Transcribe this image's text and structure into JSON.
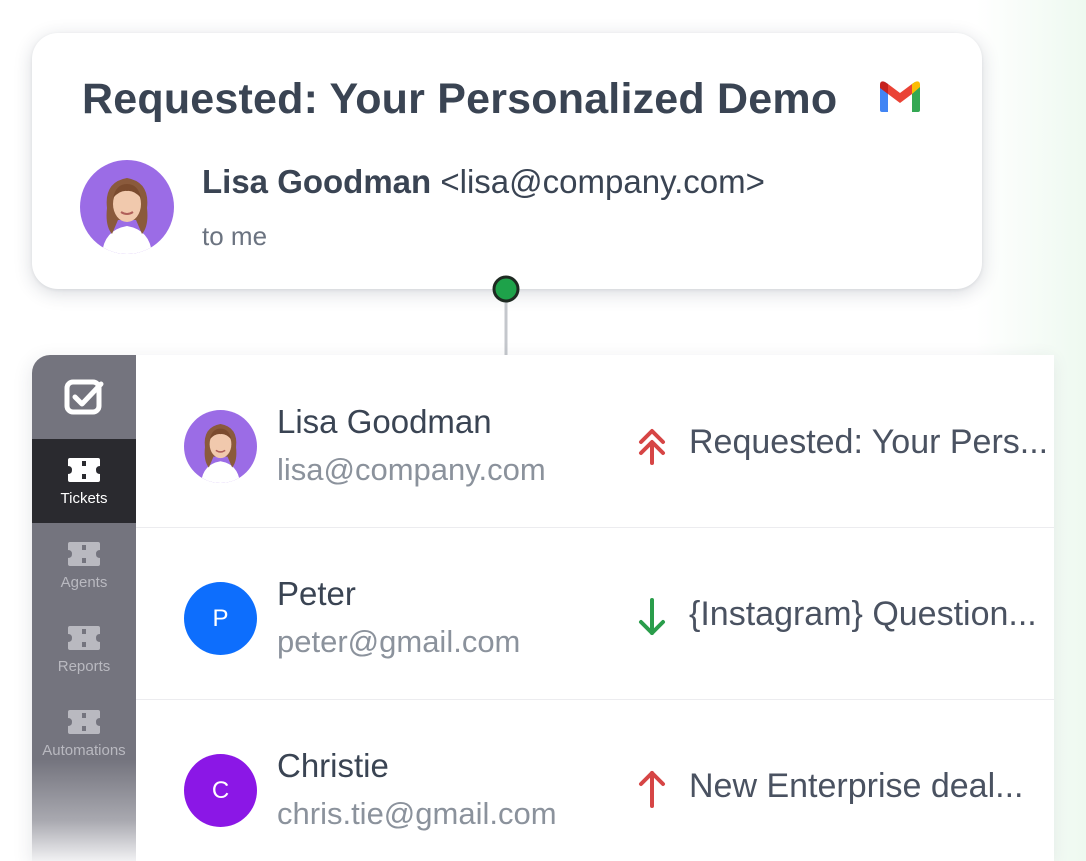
{
  "email": {
    "subject": "Requested: Your Personalized Demo",
    "sender_name": "Lisa Goodman",
    "sender_email": "<lisa@company.com>",
    "recipient": "to me",
    "client_icon": "gmail-icon"
  },
  "sidebar": {
    "logo_icon": "checkbox-logo-icon",
    "items": [
      {
        "label": "Tickets",
        "icon": "ticket-icon",
        "active": true
      },
      {
        "label": "Agents",
        "icon": "ticket-icon",
        "active": false
      },
      {
        "label": "Reports",
        "icon": "ticket-icon",
        "active": false
      },
      {
        "label": "Automations",
        "icon": "ticket-icon",
        "active": false
      }
    ]
  },
  "tickets": [
    {
      "name": "Lisa Goodman",
      "email": "lisa@company.com",
      "avatar": "photo",
      "priority": "urgent",
      "priority_icon": "double-chevron-up-icon",
      "priority_color": "#d64545",
      "subject": "Requested: Your Pers..."
    },
    {
      "name": "Peter",
      "email": "peter@gmail.com",
      "avatar": "P",
      "avatar_color": "#0d6efd",
      "priority": "low",
      "priority_icon": "arrow-down-icon",
      "priority_color": "#2a9d4b",
      "subject": "{Instagram} Question..."
    },
    {
      "name": "Christie",
      "email": "chris.tie@gmail.com",
      "avatar": "C",
      "avatar_color": "#8b17e6",
      "priority": "high",
      "priority_icon": "arrow-up-icon",
      "priority_color": "#d64545",
      "subject": "New Enterprise deal..."
    }
  ],
  "colors": {
    "connector_dot": "#1ea24a",
    "sidebar_bg": "#74747e",
    "sidebar_active": "#2a2a2f",
    "text_primary": "#3a4453"
  }
}
